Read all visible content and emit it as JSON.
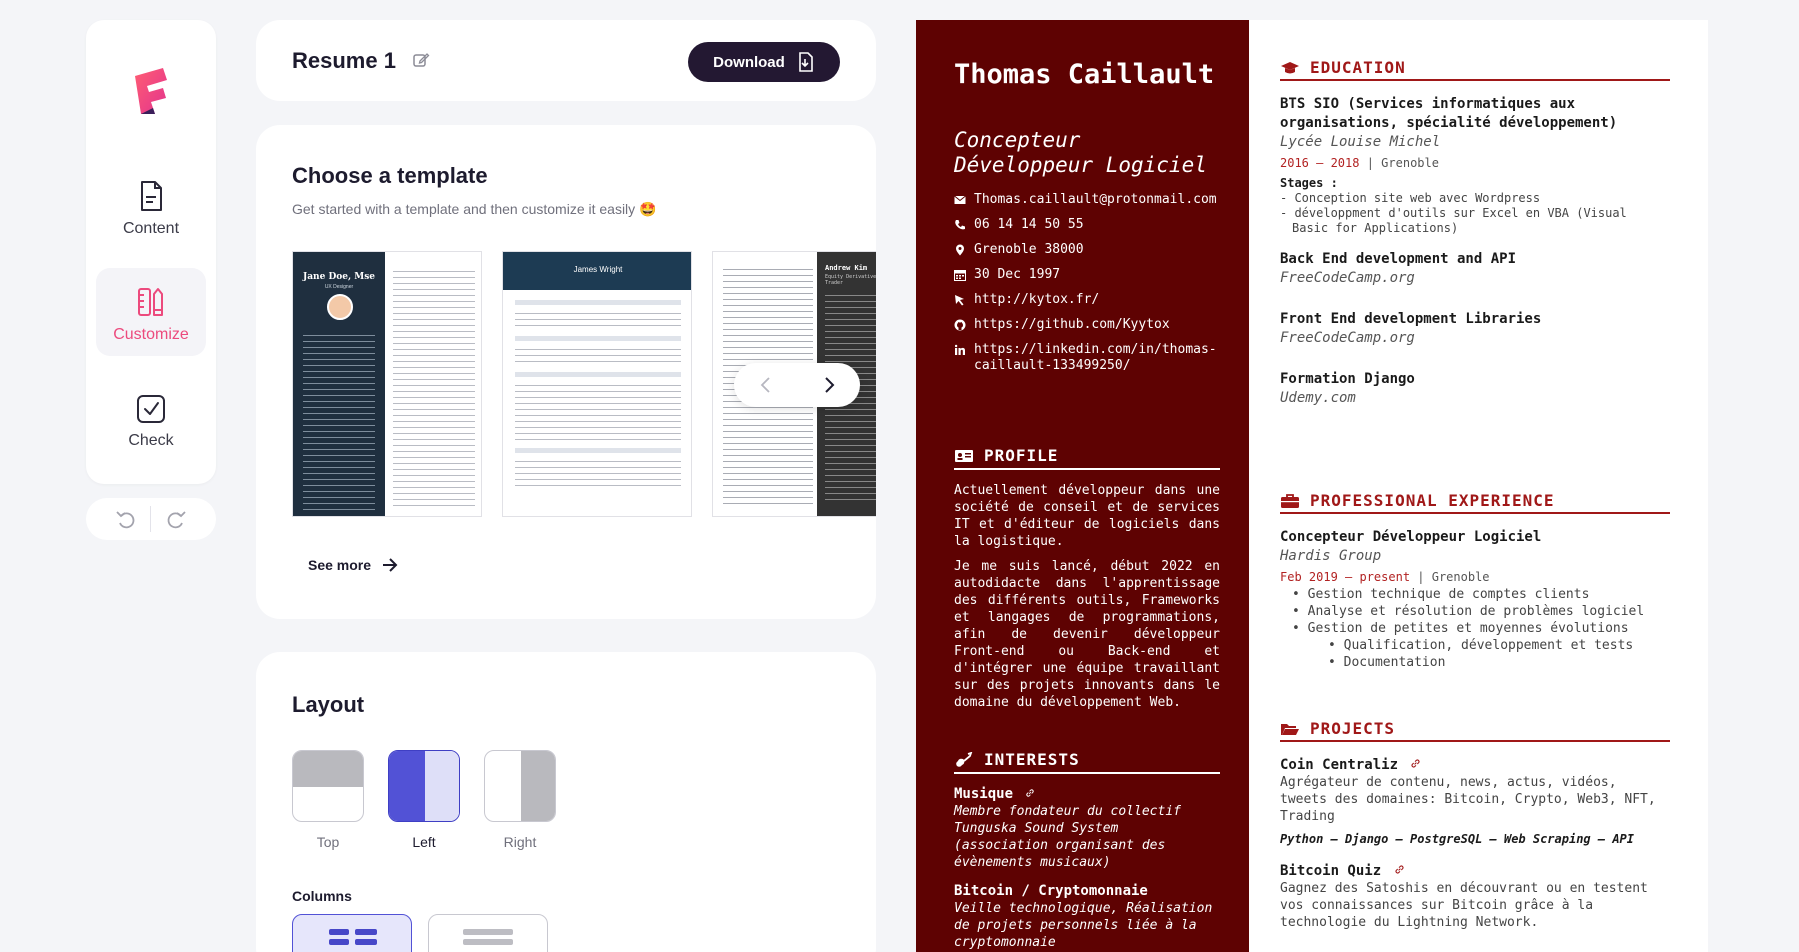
{
  "sidebar": {
    "items": [
      {
        "label": "Content",
        "icon": "document-icon"
      },
      {
        "label": "Customize",
        "icon": "ruler-pencil-icon"
      },
      {
        "label": "Check",
        "icon": "check-square-icon"
      }
    ],
    "active": "Customize",
    "accent": "#ec4a7d"
  },
  "header": {
    "resume_title": "Resume 1",
    "download_label": "Download"
  },
  "templates": {
    "title": "Choose a template",
    "subtitle": "Get started with a template and then customize it easily 🤩",
    "see_more": "See more",
    "previews": [
      {
        "name": "Jane Doe, Mse",
        "role": "UX Designer"
      },
      {
        "name": "James Wright"
      },
      {
        "name": "Andrew Kim",
        "role": "Equity Derivatives Trader"
      }
    ]
  },
  "layout": {
    "title": "Layout",
    "options": [
      "Top",
      "Left",
      "Right"
    ],
    "selected": "Left",
    "columns_label": "Columns"
  },
  "resume": {
    "name": "Thomas Caillault",
    "role": "Concepteur Développeur Logiciel",
    "colors": {
      "sidebar": "#5e0202",
      "accent": "#a01818"
    },
    "contacts": [
      {
        "icon": "mail-icon",
        "text": "Thomas.caillault@protonmail.com"
      },
      {
        "icon": "phone-icon",
        "text": "06 14 14 50 55"
      },
      {
        "icon": "location-icon",
        "text": "Grenoble 38000"
      },
      {
        "icon": "calendar-icon",
        "text": "30 Dec 1997"
      },
      {
        "icon": "cursor-icon",
        "text": "http://kytox.fr/"
      },
      {
        "icon": "github-icon",
        "text": "https://github.com/Kyytox"
      },
      {
        "icon": "linkedin-icon",
        "text": "https://linkedin.com/in/thomas-caillault-133499250/"
      }
    ],
    "profile": {
      "title": "PROFILE",
      "paragraphs": [
        "Actuellement développeur dans une société de conseil et de services IT et d'éditeur de logiciels dans la logistique.",
        "Je me suis lancé, début 2022 en autodidacte dans l'apprentissage des différents outils, Frameworks et langages de programmations, afin de devenir développeur Front-end ou Back-end et d'intégrer une équipe travaillant sur des projets innovants dans le domaine du développement Web."
      ]
    },
    "interests": {
      "title": "INTERESTS",
      "items": [
        {
          "title": "Musique",
          "desc": "Membre fondateur du collectif Tunguska Sound System (association organisant des évènements musicaux)"
        },
        {
          "title": "Bitcoin / Cryptomonnaie",
          "desc": "Veille technologique, Réalisation de projets personnels liée à la cryptomonnaie"
        }
      ]
    },
    "education": {
      "title": "EDUCATION",
      "items": [
        {
          "title": "BTS SIO (Services informatiques aux organisations, spécialité développement)",
          "inst": "Lycée Louise Michel",
          "dates": "2016 – 2018",
          "location": "Grenoble",
          "stages_label": "Stages :",
          "stages": [
            "Conception site web avec Wordpress",
            "développment d'outils sur Excel en VBA (Visual Basic for Applications)"
          ]
        },
        {
          "title": "Back End development and API",
          "inst": "FreeCodeCamp.org"
        },
        {
          "title": "Front End development Libraries",
          "inst": "FreeCodeCamp.org"
        },
        {
          "title": "Formation Django",
          "inst": "Udemy.com"
        }
      ]
    },
    "experience": {
      "title": "PROFESSIONAL EXPERIENCE",
      "job_title": "Concepteur Développeur Logiciel",
      "company": "Hardis Group",
      "dates": "Feb 2019 – present",
      "location": "Grenoble",
      "bullets": [
        "Gestion technique de comptes clients",
        "Analyse et résolution de problèmes logiciel",
        "Gestion de petites et moyennes évolutions"
      ],
      "sub_bullets": [
        "Qualification, développement et tests",
        "Documentation"
      ]
    },
    "projects": {
      "title": "PROJECTS",
      "items": [
        {
          "title": "Coin Centraliz",
          "desc": "Agrégateur de contenu, news, actus, vidéos, tweets des domaines: Bitcoin, Crypto, Web3, NFT, Trading",
          "tech": "Python – Django – PostgreSQL – Web Scraping – API"
        },
        {
          "title": "Bitcoin Quiz",
          "desc": "Gagnez des Satoshis en découvrant ou en testent vos connaissances sur Bitcoin grâce à la technologie du Lightning Network."
        }
      ]
    }
  }
}
